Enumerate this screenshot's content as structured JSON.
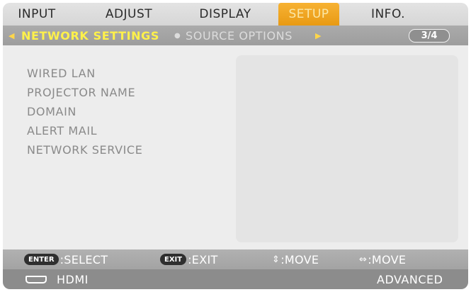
{
  "tabs": [
    {
      "label": "INPUT"
    },
    {
      "label": "ADJUST"
    },
    {
      "label": "DISPLAY"
    },
    {
      "label": "SETUP",
      "active": true
    },
    {
      "label": "INFO."
    }
  ],
  "subtabs": {
    "left_arrow": "◀",
    "right_arrow": "▶",
    "separator": "●",
    "items": [
      {
        "label": "NETWORK SETTINGS",
        "active": true
      },
      {
        "label": "SOURCE OPTIONS"
      }
    ],
    "page": "3/4"
  },
  "menu": {
    "items": [
      {
        "label": "WIRED LAN"
      },
      {
        "label": "PROJECTOR NAME"
      },
      {
        "label": "DOMAIN"
      },
      {
        "label": "ALERT MAIL"
      },
      {
        "label": "NETWORK SERVICE"
      }
    ]
  },
  "help": {
    "enter_key": "ENTER",
    "select": ":SELECT",
    "exit_key": "EXIT",
    "exit": ":EXIT",
    "updown_glyph": "⇕",
    "move_v": ":MOVE",
    "leftright_glyph": "⇔",
    "move_h": ":MOVE"
  },
  "status": {
    "source": "HDMI",
    "mode": "ADVANCED"
  },
  "colors": {
    "active_tab": "#f0a624",
    "active_subtab": "#fff14a",
    "menu_text": "#8a8a8a"
  }
}
